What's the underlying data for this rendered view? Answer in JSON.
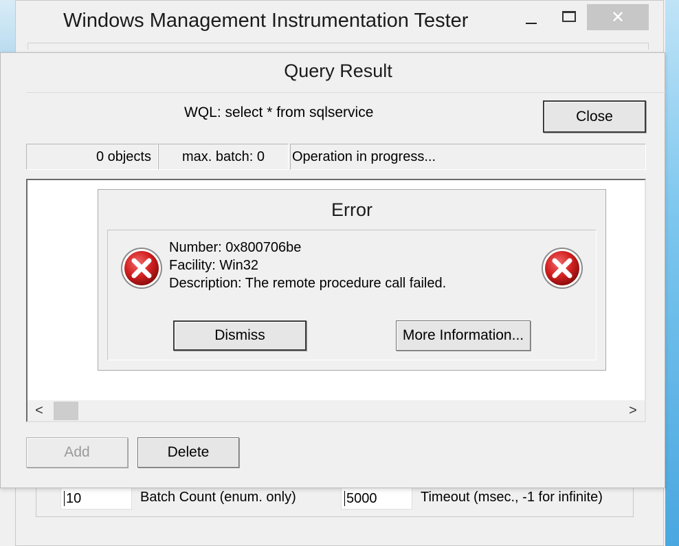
{
  "main_window": {
    "title": "Windows Management Instrumentation Tester",
    "close_glyph": "✕"
  },
  "dialog": {
    "title": "Query Result",
    "wql": "WQL: select * from sqlservice",
    "close_label": "Close",
    "status": {
      "objects": "0 objects",
      "max_batch": "max. batch: 0",
      "operation": "Operation in progress..."
    },
    "scroll_left": "<",
    "scroll_right": ">",
    "add_label": "Add",
    "delete_label": "Delete"
  },
  "error": {
    "title": "Error",
    "number": "Number: 0x800706be",
    "facility": "Facility: Win32",
    "description": "Description: The remote procedure call failed.",
    "dismiss_label": "Dismiss",
    "more_info_label": "More Information...",
    "icon": "error-x-icon",
    "icon_color": "#d11f1f"
  },
  "bottom": {
    "batch_count_value": "10",
    "batch_count_label": "Batch Count (enum. only)",
    "timeout_value": "5000",
    "timeout_label": "Timeout (msec., -1 for infinite)"
  }
}
